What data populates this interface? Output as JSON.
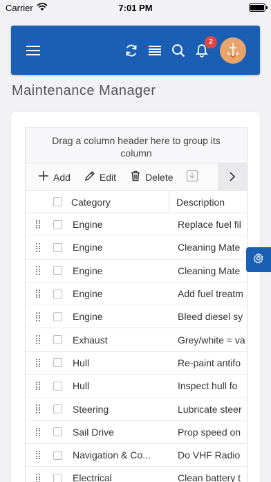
{
  "status_bar": {
    "carrier": "Carrier",
    "time": "7:01 PM"
  },
  "app_bar": {
    "background": "#1a5fb4",
    "notification_count": "2",
    "icons": [
      "menu-icon",
      "refresh-icon",
      "list-icon",
      "search-icon",
      "bell-icon",
      "avatar-boat-icon"
    ]
  },
  "page": {
    "title": "Maintenance Manager"
  },
  "grid": {
    "group_panel_text": "Drag a column header here to group its column",
    "toolbar": {
      "add_label": "Add",
      "edit_label": "Edit",
      "delete_label": "Delete"
    },
    "columns": {
      "category": "Category",
      "description": "Description"
    },
    "rows": [
      {
        "category": "Engine",
        "description": "Replace fuel fil"
      },
      {
        "category": "Engine",
        "description": "Cleaning Mate"
      },
      {
        "category": "Engine",
        "description": "Cleaning Mate"
      },
      {
        "category": "Engine",
        "description": "Add fuel treatm"
      },
      {
        "category": "Engine",
        "description": "Bleed diesel sy"
      },
      {
        "category": "Exhaust",
        "description": "Grey/white = va"
      },
      {
        "category": "Hull",
        "description": "Re-paint antifo"
      },
      {
        "category": "Hull",
        "description": "Inspect hull fo"
      },
      {
        "category": "Steering",
        "description": "Lubricate steer"
      },
      {
        "category": "Sail Drive",
        "description": "Prop speed on"
      },
      {
        "category": "Navigation & Co...",
        "description": "Do VHF Radio"
      },
      {
        "category": "Electrical",
        "description": "Clean battery t"
      }
    ]
  }
}
